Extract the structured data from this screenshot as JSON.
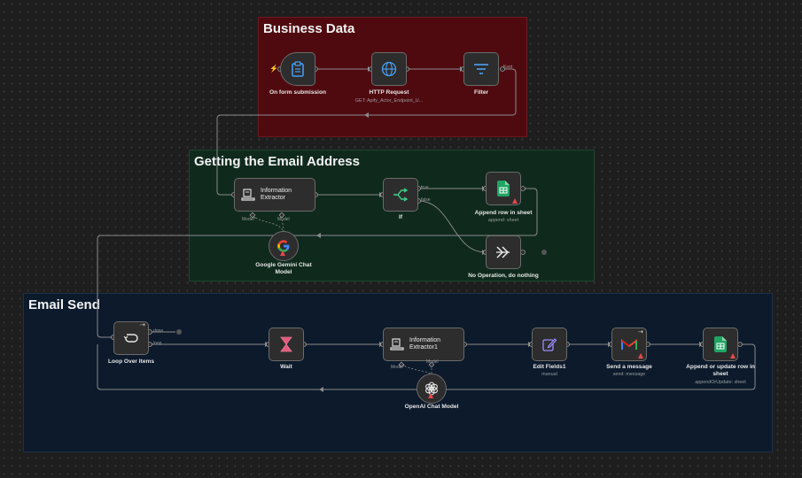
{
  "groups": {
    "business": "Business Data",
    "email_address": "Getting the Email Address",
    "email_send": "Email Send"
  },
  "nodes": {
    "form": {
      "label": "On form submission"
    },
    "http": {
      "label": "HTTP Request",
      "sub": "GET: Apify_Actor_Endpoint_U..."
    },
    "filter": {
      "label": "Filter",
      "port": "Kept"
    },
    "extractor": {
      "line1": "Information",
      "line2": "Extractor",
      "port_model": "Model*",
      "port_model2": "Model"
    },
    "if": {
      "label": "If",
      "port_true": "true",
      "port_false": "false"
    },
    "append_row": {
      "label": "Append row in sheet",
      "sub": "append: sheet"
    },
    "gemini": {
      "label_line1": "Google Gemini Chat",
      "label_line2": "Model"
    },
    "noop": {
      "label": "No Operation, do nothing"
    },
    "loop": {
      "label": "Loop Over Items",
      "port_done": "done",
      "port_loop": "loop"
    },
    "wait": {
      "label": "Wait"
    },
    "extractor1": {
      "line1": "Information",
      "line2": "Extractor1",
      "port_model": "Model*",
      "port_model2": "Model"
    },
    "openai": {
      "label": "OpenAI Chat Model"
    },
    "edit_fields": {
      "label": "Edit Fields1",
      "sub": "manual"
    },
    "send_message": {
      "label": "Send a message",
      "sub": "send: message"
    },
    "append_update": {
      "label_line1": "Append or update row in",
      "label_line2": "sheet",
      "sub": "appendOrUpdate: sheet"
    }
  },
  "colors": {
    "business_bg": "#4f0a10",
    "email_bg": "#0f2a1d",
    "send_bg": "#0c1a2c",
    "icon_blue": "#4a9ff5",
    "sheets_green": "#1fa463",
    "warning_red": "#e5484d"
  }
}
